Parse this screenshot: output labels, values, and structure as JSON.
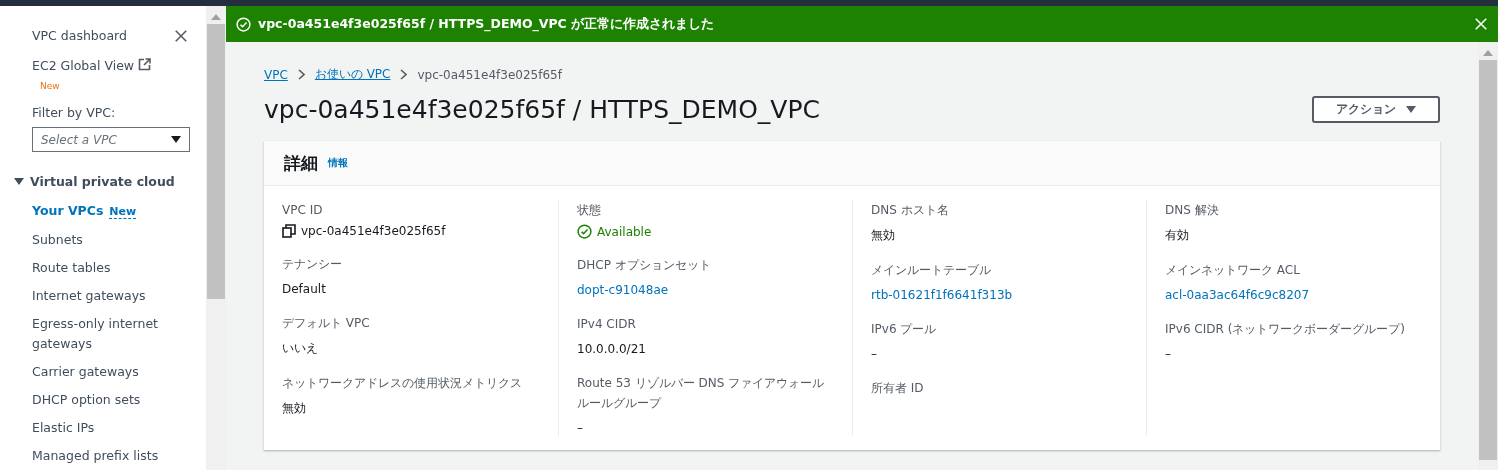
{
  "sidebar": {
    "items": [
      {
        "label": "VPC dashboard",
        "kind": "link"
      },
      {
        "label": "EC2 Global View",
        "kind": "external",
        "badge": "New"
      }
    ],
    "filter": {
      "label": "Filter by VPC:",
      "placeholder": "Select a VPC"
    },
    "section": {
      "title": "Virtual private cloud",
      "expanded": true,
      "items": [
        {
          "label": "Your VPCs",
          "selected": true,
          "badge": "New"
        },
        {
          "label": "Subnets",
          "selected": false
        },
        {
          "label": "Route tables",
          "selected": false
        },
        {
          "label": "Internet gateways",
          "selected": false
        },
        {
          "label": "Egress-only internet gateways",
          "selected": false
        },
        {
          "label": "Carrier gateways",
          "selected": false
        },
        {
          "label": "DHCP option sets",
          "selected": false
        },
        {
          "label": "Elastic IPs",
          "selected": false
        },
        {
          "label": "Managed prefix lists",
          "selected": false
        }
      ]
    }
  },
  "notification": {
    "message": "vpc-0a451e4f3e025f65f / HTTPS_DEMO_VPC が正常に作成されました"
  },
  "breadcrumbs": [
    {
      "label": "VPC",
      "kind": "link"
    },
    {
      "label": "お使いの VPC",
      "kind": "link"
    },
    {
      "label": "vpc-0a451e4f3e025f65f",
      "kind": "current"
    }
  ],
  "page_title": "vpc-0a451e4f3e025f65f / HTTPS_DEMO_VPC",
  "actions_button": {
    "label": "アクション"
  },
  "details": {
    "title": "詳細",
    "info": "情報",
    "columns": [
      [
        {
          "label": "VPC ID",
          "value": "vpc-0a451e4f3e025f65f",
          "kind": "copy"
        },
        {
          "label": "テナンシー",
          "value": "Default",
          "kind": "text"
        },
        {
          "label": "デフォルト VPC",
          "value": "いいえ",
          "kind": "text"
        },
        {
          "label": "ネットワークアドレスの使用状況メトリクス",
          "value": "無効",
          "kind": "text"
        }
      ],
      [
        {
          "label": "状態",
          "value": "Available",
          "kind": "status"
        },
        {
          "label": "DHCP オプションセット",
          "value": "dopt-c91048ae",
          "kind": "link"
        },
        {
          "label": "IPv4 CIDR",
          "value": "10.0.0.0/21",
          "kind": "text"
        },
        {
          "label": "Route 53 リゾルバー DNS ファイアウォールルールグループ",
          "value": "–",
          "kind": "text"
        }
      ],
      [
        {
          "label": "DNS ホスト名",
          "value": "無効",
          "kind": "text"
        },
        {
          "label": "メインルートテーブル",
          "value": "rtb-01621f1f6641f313b",
          "kind": "link"
        },
        {
          "label": "IPv6 プール",
          "value": "–",
          "kind": "text"
        },
        {
          "label": "所有者 ID",
          "kind": "text"
        }
      ],
      [
        {
          "label": "DNS 解決",
          "value": "有効",
          "kind": "text"
        },
        {
          "label": "メインネットワーク ACL",
          "value": "acl-0aa3ac64f6c9c8207",
          "kind": "link"
        },
        {
          "label": "IPv6 CIDR (ネットワークボーダーグループ)",
          "value": "–",
          "kind": "text"
        }
      ]
    ]
  }
}
